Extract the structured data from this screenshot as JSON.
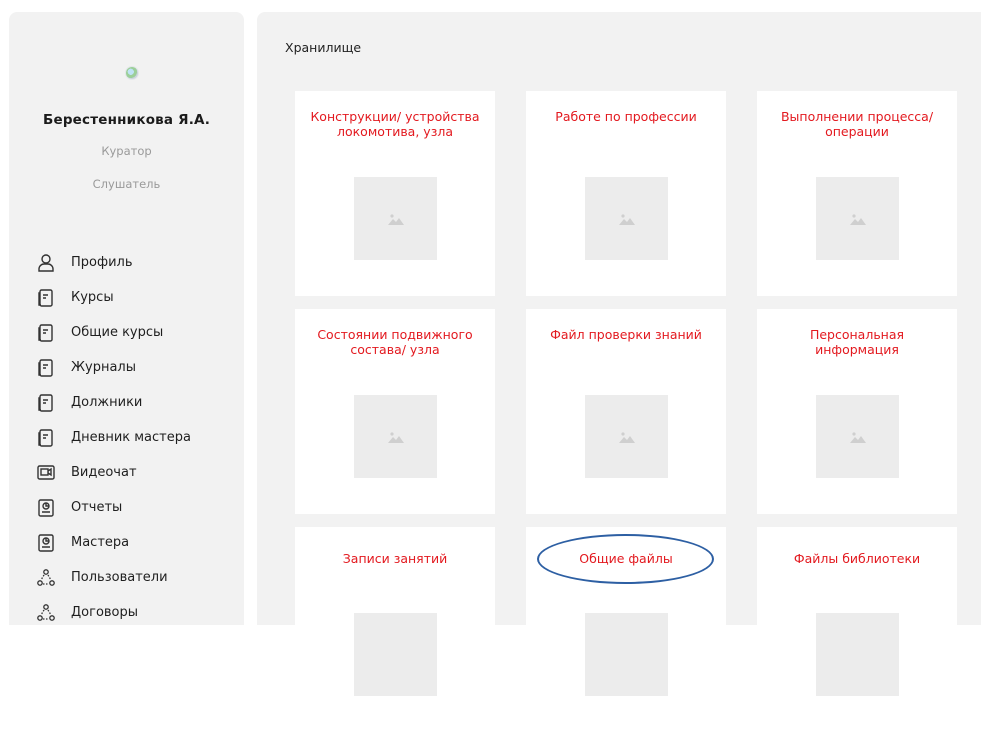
{
  "sidebar": {
    "user_name": "Берестенникова Я.А.",
    "roles": [
      "Куратор",
      "Слушатель"
    ],
    "menu": [
      {
        "label": "Профиль",
        "icon": "user-icon"
      },
      {
        "label": "Курсы",
        "icon": "document-icon"
      },
      {
        "label": "Общие курсы",
        "icon": "document-icon"
      },
      {
        "label": "Журналы",
        "icon": "document-icon"
      },
      {
        "label": "Должники",
        "icon": "document-icon"
      },
      {
        "label": "Дневник мастера",
        "icon": "document-icon"
      },
      {
        "label": "Видеочат",
        "icon": "video-icon"
      },
      {
        "label": "Отчеты",
        "icon": "report-icon"
      },
      {
        "label": "Мастера",
        "icon": "report-icon"
      },
      {
        "label": "Пользователи",
        "icon": "users-icon"
      },
      {
        "label": "Договоры",
        "icon": "users-icon"
      }
    ]
  },
  "main": {
    "title": "Хранилище",
    "cards": [
      {
        "title": "Конструкции/ устройства локомотива, узла"
      },
      {
        "title": "Работе по профессии"
      },
      {
        "title": "Выполнении процесса/операции"
      },
      {
        "title": "Состоянии подвижного состава/ узла"
      },
      {
        "title": "Файл проверки знаний"
      },
      {
        "title": "Персональная информация"
      },
      {
        "title": "Записи занятий"
      },
      {
        "title": "Общие файлы"
      },
      {
        "title": "Файлы библиотеки"
      }
    ]
  },
  "colors": {
    "panel_bg": "#f2f2f2",
    "card_title": "#e3191f",
    "highlight": "#2d5fa3",
    "thumb_bg": "#ececec"
  }
}
